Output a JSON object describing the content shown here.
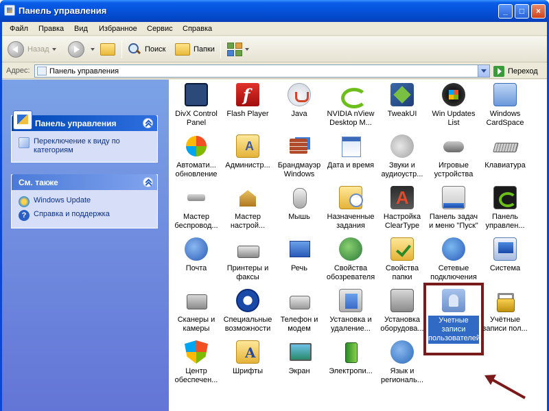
{
  "window": {
    "title": "Панель управления"
  },
  "menu": [
    "Файл",
    "Правка",
    "Вид",
    "Избранное",
    "Сервис",
    "Справка"
  ],
  "toolbar": {
    "back": "Назад",
    "search": "Поиск",
    "folders": "Папки"
  },
  "address": {
    "label": "Адрес:",
    "value": "Панель управления",
    "go": "Переход"
  },
  "taskpane": {
    "cp_title": "Панель управления",
    "switch_link": "Переключение к виду по категориям",
    "see_also_title": "См. также",
    "links": [
      "Windows Update",
      "Справка и поддержка"
    ]
  },
  "items": [
    {
      "label": "DivX Control Panel",
      "icon": "divx-icon",
      "cls": "ic-divx"
    },
    {
      "label": "Flash Player",
      "icon": "flash-player-icon",
      "cls": "ic-flash"
    },
    {
      "label": "Java",
      "icon": "java-icon",
      "cls": "ic-java"
    },
    {
      "label": "NVIDIA nView Desktop M...",
      "icon": "nvidia-icon",
      "cls": "ic-nvidia"
    },
    {
      "label": "TweakUI",
      "icon": "tweakui-icon",
      "cls": "ic-tweak"
    },
    {
      "label": "Win Updates List",
      "icon": "win-updates-icon",
      "cls": "ic-winupd"
    },
    {
      "label": "Windows CardSpace",
      "icon": "cardspace-icon",
      "cls": "ic-cardspace"
    },
    {
      "label": "Автомати... обновление",
      "icon": "automatic-updates-icon",
      "cls": "ic-update"
    },
    {
      "label": "Администр...",
      "icon": "admin-tools-icon",
      "cls": "ic-folder-a"
    },
    {
      "label": "Брандмауэр Windows",
      "icon": "firewall-icon",
      "cls": "ic-firewall"
    },
    {
      "label": "Дата и время",
      "icon": "date-time-icon",
      "cls": "ic-datetime"
    },
    {
      "label": "Звуки и аудиоустр...",
      "icon": "sound-icon",
      "cls": "ic-sound"
    },
    {
      "label": "Игровые устройства",
      "icon": "gamepad-icon",
      "cls": "ic-gamepad"
    },
    {
      "label": "Клавиатура",
      "icon": "keyboard-icon",
      "cls": "ic-keyboard"
    },
    {
      "label": "Мастер беспровод...",
      "icon": "wireless-wizard-icon",
      "cls": "ic-wifi"
    },
    {
      "label": "Мастер настрой...",
      "icon": "network-setup-icon",
      "cls": "ic-netsetup"
    },
    {
      "label": "Мышь",
      "icon": "mouse-icon",
      "cls": "ic-mouse"
    },
    {
      "label": "Назначенные задания",
      "icon": "scheduled-tasks-icon",
      "cls": "ic-tasks"
    },
    {
      "label": "Настройка ClearType",
      "icon": "cleartype-icon",
      "cls": "ic-cleartype"
    },
    {
      "label": "Панель задач и меню \"Пуск\"",
      "icon": "taskbar-icon",
      "cls": "ic-taskbar"
    },
    {
      "label": "Панель управлен...",
      "icon": "nvidia-panel-icon",
      "cls": "ic-nvpanel"
    },
    {
      "label": "Почта",
      "icon": "mail-icon",
      "cls": "ic-mail"
    },
    {
      "label": "Принтеры и факсы",
      "icon": "printer-icon",
      "cls": "ic-printer"
    },
    {
      "label": "Речь",
      "icon": "speech-icon",
      "cls": "ic-speech"
    },
    {
      "label": "Свойства обозревателя",
      "icon": "internet-options-icon",
      "cls": "ic-inetopts"
    },
    {
      "label": "Свойства папки",
      "icon": "folder-options-icon",
      "cls": "ic-folderopts"
    },
    {
      "label": "Сетевые подключения",
      "icon": "network-connections-icon",
      "cls": "ic-netconn"
    },
    {
      "label": "Система",
      "icon": "system-icon",
      "cls": "ic-system"
    },
    {
      "label": "Сканеры и камеры",
      "icon": "scanner-icon",
      "cls": "ic-scanner"
    },
    {
      "label": "Специальные возможности",
      "icon": "accessibility-icon",
      "cls": "ic-access"
    },
    {
      "label": "Телефон и модем",
      "icon": "phone-icon",
      "cls": "ic-phone"
    },
    {
      "label": "Установка и удаление...",
      "icon": "add-remove-icon",
      "cls": "ic-addremove"
    },
    {
      "label": "Установка оборудова...",
      "icon": "hardware-icon",
      "cls": "ic-hardware"
    },
    {
      "label": "Учетные записи пользователей",
      "icon": "user-accounts-icon",
      "cls": "ic-useracc",
      "selected": true
    },
    {
      "label": "Учётные записи пол...",
      "icon": "lock-icon",
      "cls": "ic-lock"
    },
    {
      "label": "Центр обеспечен...",
      "icon": "security-center-icon",
      "cls": "ic-security"
    },
    {
      "label": "Шрифты",
      "icon": "fonts-icon",
      "cls": "ic-fonts"
    },
    {
      "label": "Экран",
      "icon": "display-icon",
      "cls": "ic-display"
    },
    {
      "label": "Электропи...",
      "icon": "power-icon",
      "cls": "ic-power"
    },
    {
      "label": "Язык и региональ...",
      "icon": "region-icon",
      "cls": "ic-region"
    }
  ],
  "colors": {
    "selection": "#316ac5",
    "annotation": "#7a1a1a",
    "taskpane": "#7ba2e7"
  }
}
